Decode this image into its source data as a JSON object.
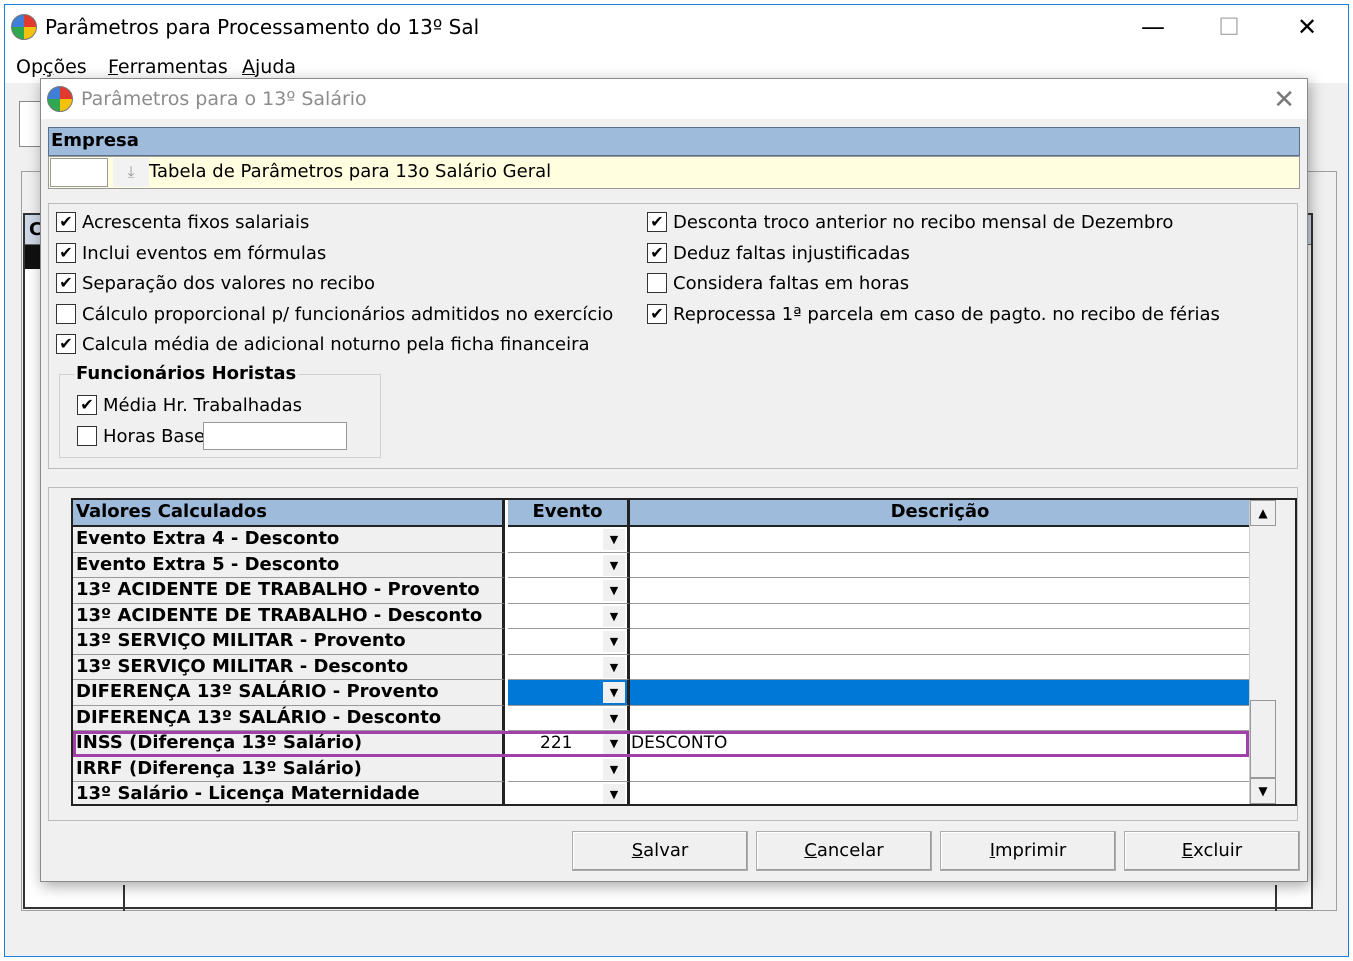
{
  "main_window": {
    "title": "Parâmetros para Processamento do 13º Sal",
    "controls": {
      "minimize": "—",
      "maximize": "☐",
      "close": "✕"
    },
    "menu": [
      {
        "pre": "Op",
        "key": "ç",
        "post": "ões"
      },
      {
        "pre": "",
        "key": "F",
        "post": "erramentas"
      },
      {
        "pre": "",
        "key": "A",
        "post": "juda"
      }
    ],
    "grid_label": "C"
  },
  "dialog": {
    "title": "Parâmetros para o 13º Salário",
    "close_glyph": "✕",
    "empresa": {
      "header": "Empresa",
      "code_value": "",
      "lookup_glyph": "⤓",
      "name": "Tabela de Parâmetros para 13o Salário Geral"
    },
    "options_left": [
      {
        "label": "Acrescenta fixos salariais",
        "checked": true
      },
      {
        "label": "Inclui eventos em fórmulas",
        "checked": true
      },
      {
        "label": "Separação dos valores no recibo",
        "checked": true
      },
      {
        "label": "Cálculo proporcional p/ funcionários admitidos no exercício",
        "checked": false
      },
      {
        "label": "Calcula média de adicional noturno pela ficha financeira",
        "checked": true
      }
    ],
    "options_right": [
      {
        "label": "Desconta troco anterior no recibo mensal de Dezembro",
        "checked": true
      },
      {
        "label": "Deduz faltas injustificadas",
        "checked": true
      },
      {
        "label": "Considera faltas em horas",
        "checked": false
      },
      {
        "label": "Reprocessa 1ª parcela em caso de pagto. no recibo de férias",
        "checked": true
      }
    ],
    "horistas": {
      "title": "Funcionários Horistas",
      "media_label": "Média Hr. Trabalhadas",
      "media_checked": true,
      "horas_base_label": "Horas Base",
      "horas_base_checked": false,
      "horas_base_value": ""
    },
    "table": {
      "headers": {
        "valores": "Valores Calculados",
        "evento": "Evento",
        "descricao": "Descrição"
      },
      "rows": [
        {
          "label": "Evento Extra 4 - Desconto",
          "evento": "",
          "descricao": ""
        },
        {
          "label": "Evento Extra 5 - Desconto",
          "evento": "",
          "descricao": ""
        },
        {
          "label": "13º ACIDENTE DE TRABALHO - Provento",
          "evento": "",
          "descricao": ""
        },
        {
          "label": "13º ACIDENTE DE TRABALHO - Desconto",
          "evento": "",
          "descricao": ""
        },
        {
          "label": "13º SERVIÇO MILITAR - Provento",
          "evento": "",
          "descricao": ""
        },
        {
          "label": "13º SERVIÇO MILITAR - Desconto",
          "evento": "",
          "descricao": ""
        },
        {
          "label": "DIFERENÇA 13º SALÁRIO - Provento",
          "evento": "",
          "descricao": "",
          "selected": true
        },
        {
          "label": "DIFERENÇA 13º SALÁRIO - Desconto",
          "evento": "",
          "descricao": ""
        },
        {
          "label": "INSS (Diferença 13º Salário)",
          "evento": "221",
          "descricao": "DESCONTO",
          "highlighted": true
        },
        {
          "label": "IRRF (Diferença 13º Salário)",
          "evento": "",
          "descricao": ""
        },
        {
          "label": "13º Salário - Licença Maternidade",
          "evento": "",
          "descricao": ""
        }
      ],
      "dropdown_glyph": "▼",
      "scroll_up_glyph": "▲",
      "scroll_down_glyph": "▼"
    },
    "buttons": [
      {
        "name": "salvar-button",
        "key": "S",
        "post": "alvar"
      },
      {
        "name": "cancelar-button",
        "key": "C",
        "post": "ancelar"
      },
      {
        "name": "imprimir-button",
        "key": "I",
        "post": "mprimir"
      },
      {
        "name": "excluir-button",
        "key": "E",
        "post": "xcluir"
      }
    ]
  },
  "colors": {
    "header_blue": "#9fbbdc",
    "selection_blue": "#0078d7",
    "highlight_purple": "#a040a8",
    "empresa_bg": "#ffffe0"
  }
}
